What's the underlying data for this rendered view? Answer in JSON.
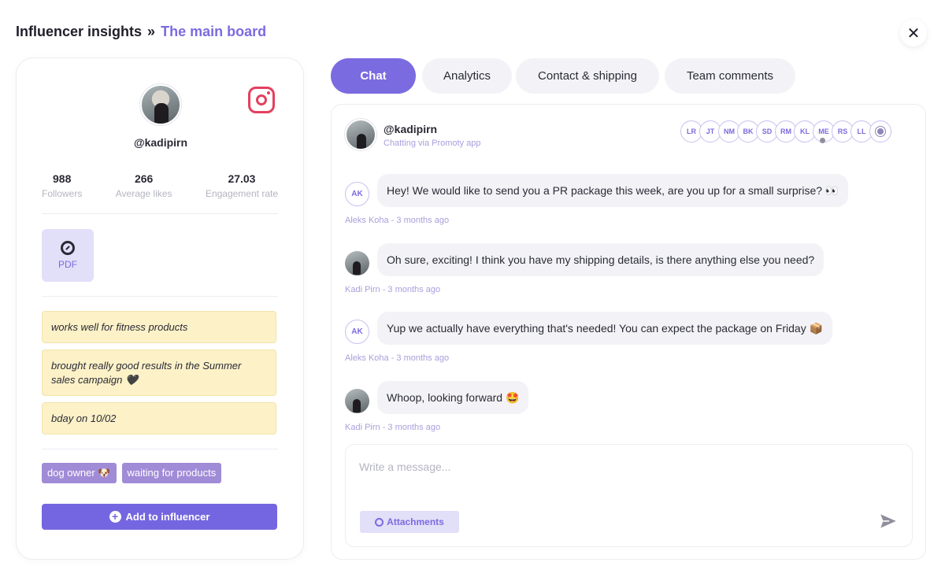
{
  "header": {
    "root_label": "Influencer insights",
    "separator": "»",
    "current_label": "The main board",
    "close_label": "✕"
  },
  "profile": {
    "handle": "@kadipirn",
    "platform_icon": "instagram-icon",
    "stats": [
      {
        "value": "988",
        "label": "Followers"
      },
      {
        "value": "266",
        "label": "Average likes"
      },
      {
        "value": "27.03",
        "label": "Engagement rate"
      }
    ],
    "attachment": {
      "label": "PDF",
      "icon": "attachment-icon"
    },
    "notes": [
      "works well for fitness products",
      "brought really good results in the Summer sales campaign 🖤",
      "bday on 10/02"
    ],
    "tags": [
      "dog owner 🐶",
      "waiting for products"
    ],
    "add_button_label": "Add to influencer"
  },
  "tabs": [
    {
      "label": "Chat",
      "active": true
    },
    {
      "label": "Analytics",
      "active": false
    },
    {
      "label": "Contact & shipping",
      "active": false
    },
    {
      "label": "Team comments",
      "active": false
    }
  ],
  "chat": {
    "handle": "@kadipirn",
    "subtitle": "Chatting via Promoty app",
    "members": [
      "LR",
      "JT",
      "NM",
      "BK",
      "SD",
      "RM",
      "KL",
      "ME",
      "RS",
      "LL"
    ],
    "messages": [
      {
        "avatar": "AK",
        "text": "Hey! We would like to send you a PR package this week, are you up for a small surprise? 👀",
        "meta": "Aleks Koha - 3 months ago"
      },
      {
        "avatar": "",
        "text": "Oh sure, exciting! I think you have my shipping details, is there anything else you need?",
        "meta": "Kadi Pirn - 3 months ago"
      },
      {
        "avatar": "AK",
        "text": "Yup we actually have everything that's needed! You can expect the package on Friday 📦",
        "meta": "Aleks Koha - 3 months ago"
      },
      {
        "avatar": "",
        "text": "Whoop, looking forward 🤩",
        "meta": "Kadi Pirn - 3 months ago"
      }
    ],
    "composer": {
      "placeholder": "Write a message...",
      "attach_label": "Attachments",
      "send_icon": "send-icon"
    }
  },
  "colors": {
    "accent": "#7b6be0",
    "note_bg": "#fcf1c7",
    "tag_bg": "#a08bd7"
  }
}
